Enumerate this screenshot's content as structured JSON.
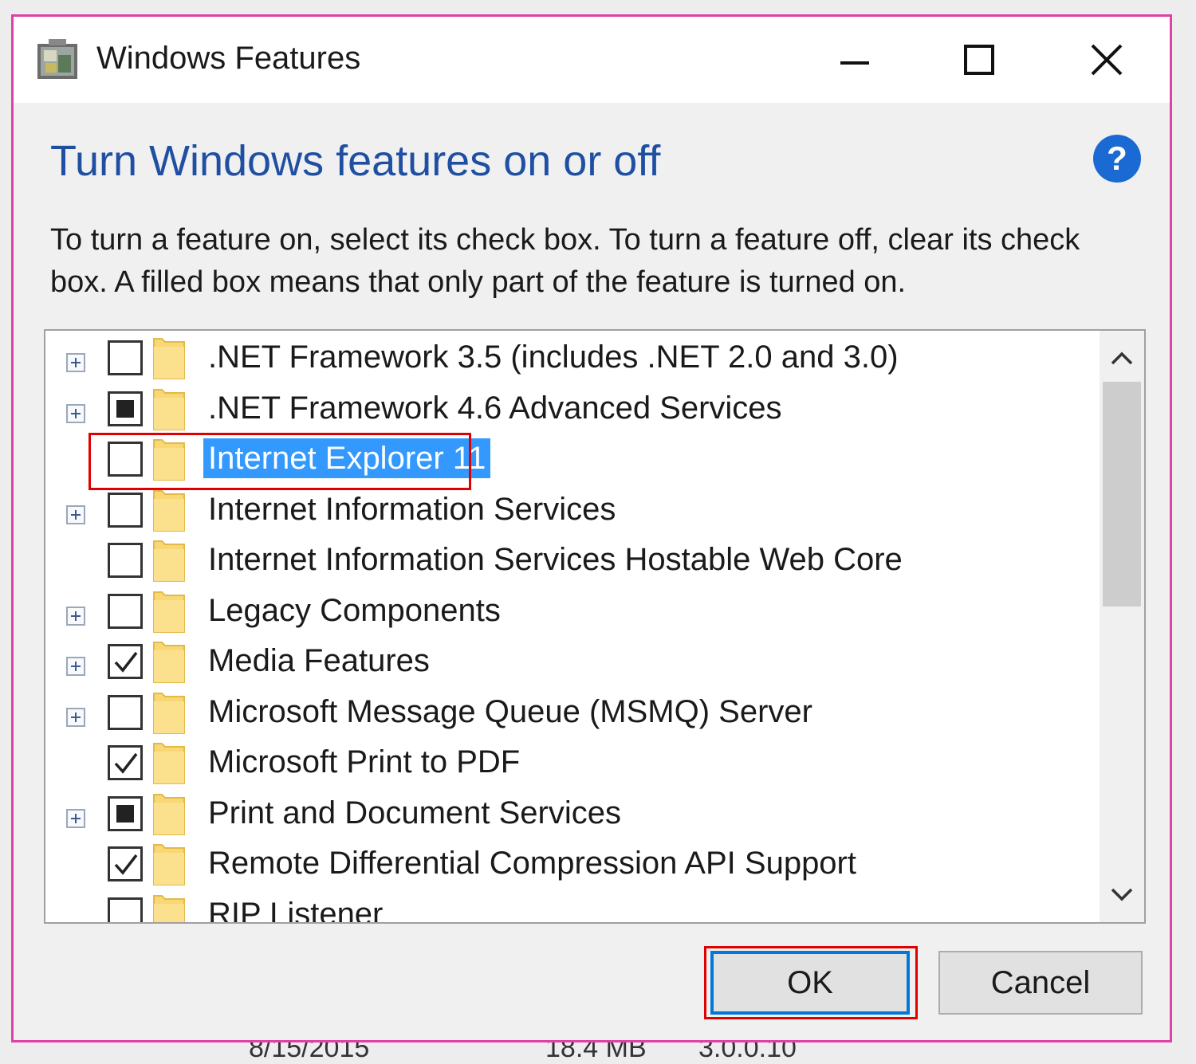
{
  "window": {
    "title": "Windows Features"
  },
  "header": {
    "heading": "Turn Windows features on or off",
    "help_label": "?",
    "description": "To turn a feature on, select its check box. To turn a feature off, clear its check box. A filled box means that only part of the feature is turned on."
  },
  "features": [
    {
      "label": ".NET Framework 3.5 (includes .NET 2.0 and 3.0)",
      "state": "unchecked",
      "expandable": true
    },
    {
      "label": ".NET Framework 4.6 Advanced Services",
      "state": "partial",
      "expandable": true
    },
    {
      "label": "Internet Explorer 11",
      "state": "unchecked",
      "expandable": false,
      "selected": true
    },
    {
      "label": "Internet Information Services",
      "state": "unchecked",
      "expandable": true
    },
    {
      "label": "Internet Information Services Hostable Web Core",
      "state": "unchecked",
      "expandable": false
    },
    {
      "label": "Legacy Components",
      "state": "unchecked",
      "expandable": true
    },
    {
      "label": "Media Features",
      "state": "checked",
      "expandable": true
    },
    {
      "label": "Microsoft Message Queue (MSMQ) Server",
      "state": "unchecked",
      "expandable": true
    },
    {
      "label": "Microsoft Print to PDF",
      "state": "checked",
      "expandable": false
    },
    {
      "label": "Print and Document Services",
      "state": "partial",
      "expandable": true
    },
    {
      "label": "Remote Differential Compression API Support",
      "state": "checked",
      "expandable": false
    },
    {
      "label": "RIP Listener",
      "state": "unchecked",
      "expandable": false
    }
  ],
  "buttons": {
    "ok": "OK",
    "cancel": "Cancel"
  },
  "background_row": {
    "date": "8/15/2015",
    "size": "18.4 MB",
    "version": "3.0.0.10"
  },
  "colors": {
    "heading": "#1f4fa3",
    "selection": "#3399ff",
    "annotation_red": "#e00000",
    "window_border": "#e040a8",
    "help_icon": "#1b6ad3"
  }
}
